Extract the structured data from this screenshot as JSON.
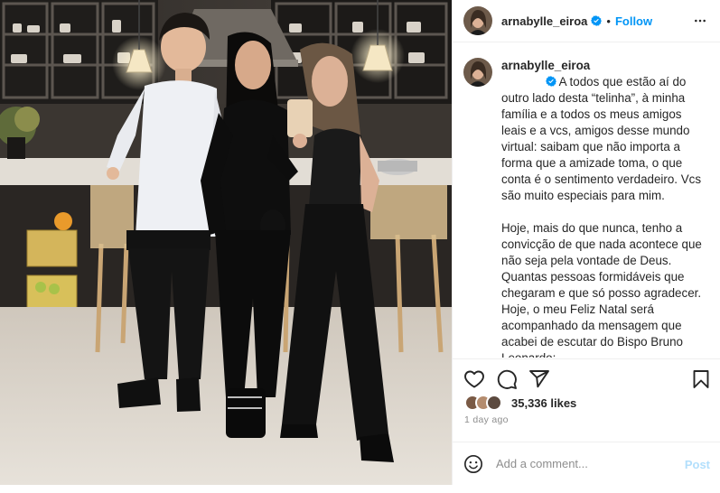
{
  "post": {
    "username": "arnabylle_eiroa",
    "verified": true,
    "follow_label": "Follow",
    "separator": "•",
    "photo_alt": "photo",
    "caption": {
      "username": "arnabylle_eiroa",
      "paragraphs": [
        "A todos que estão aí do outro lado desta “telinha”, à minha família e a todos os meus amigos leais e a vcs, amigos desse mundo virtual: saibam que não importa a forma que a amizade toma, o que conta é o sentimento verdadeiro. Vcs são muito especiais para mim.",
        "Hoje, mais do que nunca, tenho a convicção de que nada acontece que não seja pela vontade de Deus. Quantas pessoas formidáveis que chegaram e que só posso agradecer.\nHoje, o meu Feliz Natal será acompanhado da mensagem que acabei de escutar do Bispo Bruno Leonardo:"
      ]
    },
    "likes": "35,336 likes",
    "time_ago": "1 day ago",
    "comment": {
      "placeholder": "Add a comment...",
      "post_label": "Post"
    }
  },
  "icons": {
    "header_more": "more-icon",
    "verified": "verified-badge-icon",
    "like": "heart-icon",
    "comment": "comment-icon",
    "share": "share-icon",
    "save": "bookmark-icon",
    "emoji": "emoji-icon"
  },
  "colors": {
    "accent": "#0095f6",
    "verified": "#0095f6",
    "muted": "#8e8e8e",
    "text": "#262626",
    "post_disabled": "#b2dffc"
  }
}
